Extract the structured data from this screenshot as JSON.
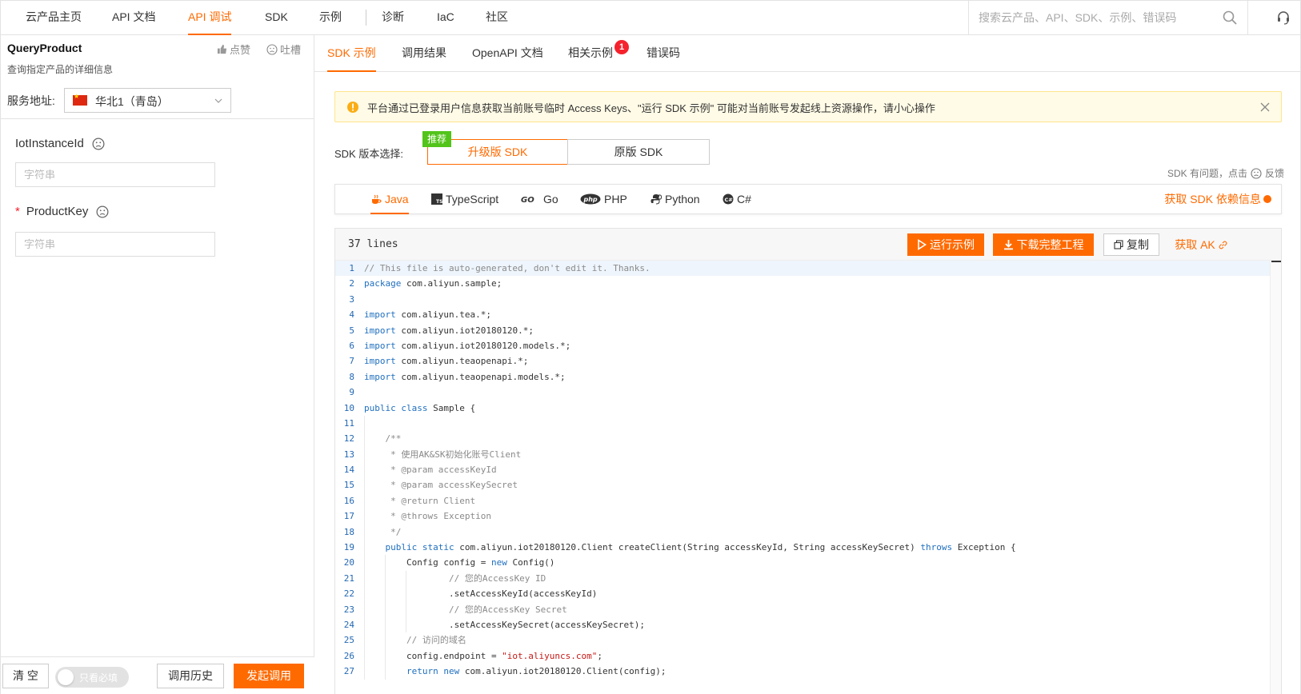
{
  "topnav": {
    "items": [
      {
        "label": "云产品主页"
      },
      {
        "label": "API 文档"
      },
      {
        "label": "API 调试",
        "active": true
      },
      {
        "label": "SDK"
      },
      {
        "label": "示例"
      },
      {
        "label": "诊断"
      },
      {
        "label": "IaC"
      },
      {
        "label": "社区"
      }
    ],
    "search_placeholder": "搜索云产品、API、SDK、示例、错误码"
  },
  "left": {
    "api_name": "QueryProduct",
    "api_desc": "查询指定产品的详细信息",
    "like_label": "点赞",
    "dislike_label": "吐槽",
    "service_label": "服务地址:",
    "region": "华北1（青岛）",
    "params": [
      {
        "name": "IotInstanceId",
        "required": false,
        "placeholder": "字符串",
        "value": ""
      },
      {
        "name": "ProductKey",
        "required": true,
        "required_mark": "*",
        "placeholder": "字符串",
        "value": ""
      }
    ],
    "footer": {
      "clear_label": "清 空",
      "required_only_label": "只看必填",
      "history_label": "调用历史",
      "invoke_label": "发起调用"
    }
  },
  "right": {
    "tabs": [
      {
        "label": "SDK 示例",
        "active": true
      },
      {
        "label": "调用结果"
      },
      {
        "label": "OpenAPI 文档"
      },
      {
        "label": "相关示例",
        "badge": "1"
      },
      {
        "label": "错误码"
      }
    ],
    "alert": "平台通过已登录用户信息获取当前账号临时 Access Keys、\"运行 SDK 示例\" 可能对当前账号发起线上资源操作，请小心操作",
    "sdk_version_label": "SDK 版本选择:",
    "recommend_tag": "推荐",
    "sdk_versions": [
      {
        "label": "升级版 SDK",
        "active": true
      },
      {
        "label": "原版 SDK"
      }
    ],
    "sdk_feedback_prefix": "SDK 有问题，点击",
    "sdk_feedback_suffix": "反馈",
    "languages": [
      {
        "label": "Java",
        "active": true,
        "icon": "java-icon"
      },
      {
        "label": "TypeScript",
        "icon": "typescript-icon"
      },
      {
        "label": "Go",
        "icon": "go-icon"
      },
      {
        "label": "PHP",
        "icon": "php-icon"
      },
      {
        "label": "Python",
        "icon": "python-icon"
      },
      {
        "label": "C#",
        "icon": "csharp-icon"
      }
    ],
    "deps_link": "获取 SDK 依赖信息",
    "code": {
      "lines_label": "37 lines",
      "run_label": "运行示例",
      "download_label": "下载完整工程",
      "copy_label": "复制",
      "ak_label": "获取 AK",
      "lines": [
        "// This file is auto-generated, don't edit it. Thanks.",
        "package com.aliyun.sample;",
        "",
        "import com.aliyun.tea.*;",
        "import com.aliyun.iot20180120.*;",
        "import com.aliyun.iot20180120.models.*;",
        "import com.aliyun.teaopenapi.*;",
        "import com.aliyun.teaopenapi.models.*;",
        "",
        "public class Sample {",
        "",
        "    /**",
        "     * 使用AK&SK初始化账号Client",
        "     * @param accessKeyId",
        "     * @param accessKeySecret",
        "     * @return Client",
        "     * @throws Exception",
        "     */",
        "    public static com.aliyun.iot20180120.Client createClient(String accessKeyId, String accessKeySecret) throws Exception {",
        "        Config config = new Config()",
        "                // 您的AccessKey ID",
        "                .setAccessKeyId(accessKeyId)",
        "                // 您的AccessKey Secret",
        "                .setAccessKeySecret(accessKeySecret);",
        "        // 访问的域名",
        "        config.endpoint = \"iot.aliyuncs.com\";",
        "        return new com.aliyun.iot20180120.Client(config);"
      ]
    }
  },
  "colors": {
    "accent": "#ff6a00",
    "badge": "#f5222d",
    "recommend": "#52c41a",
    "alert_bg": "#fffbe6"
  }
}
